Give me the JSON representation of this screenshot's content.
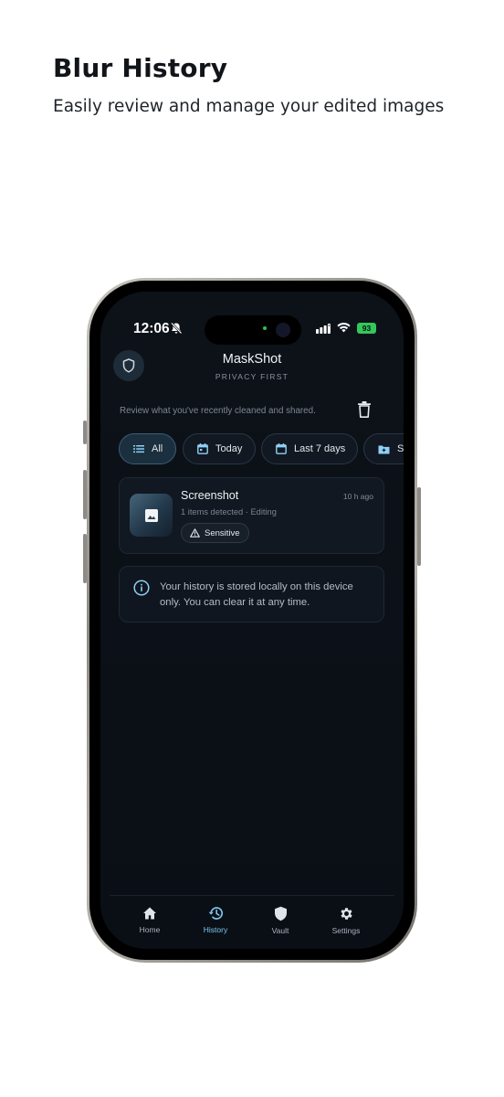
{
  "promo": {
    "title": "Blur History",
    "subtitle": "Easily review and manage your edited images"
  },
  "status_bar": {
    "time": "12:06",
    "battery": "93"
  },
  "header": {
    "app_name": "MaskShot",
    "tagline": "PRIVACY FIRST",
    "shield_icon": "shield-icon"
  },
  "review_text": "Review what you've recently cleaned and shared.",
  "filters": [
    {
      "label": "All",
      "icon": "list-icon",
      "active": true
    },
    {
      "label": "Today",
      "icon": "calendar-icon",
      "active": false
    },
    {
      "label": "Last 7 days",
      "icon": "calendar-icon",
      "active": false
    },
    {
      "label": "S",
      "icon": "folder-icon",
      "active": false
    }
  ],
  "history": [
    {
      "title": "Screenshot",
      "time": "10 h ago",
      "meta": "1 items detected · Editing",
      "badge": "Sensitive"
    }
  ],
  "info": {
    "text": "Your history is stored locally on this device only. You can clear it at any time."
  },
  "nav": [
    {
      "label": "Home",
      "icon": "home-icon",
      "active": false
    },
    {
      "label": "History",
      "icon": "history-icon",
      "active": true
    },
    {
      "label": "Vault",
      "icon": "shield-icon",
      "active": false
    },
    {
      "label": "Settings",
      "icon": "gear-icon",
      "active": false
    }
  ],
  "colors": {
    "accent": "#7fc4f0",
    "screen_bg": "#0b1017",
    "battery": "#34c759"
  }
}
